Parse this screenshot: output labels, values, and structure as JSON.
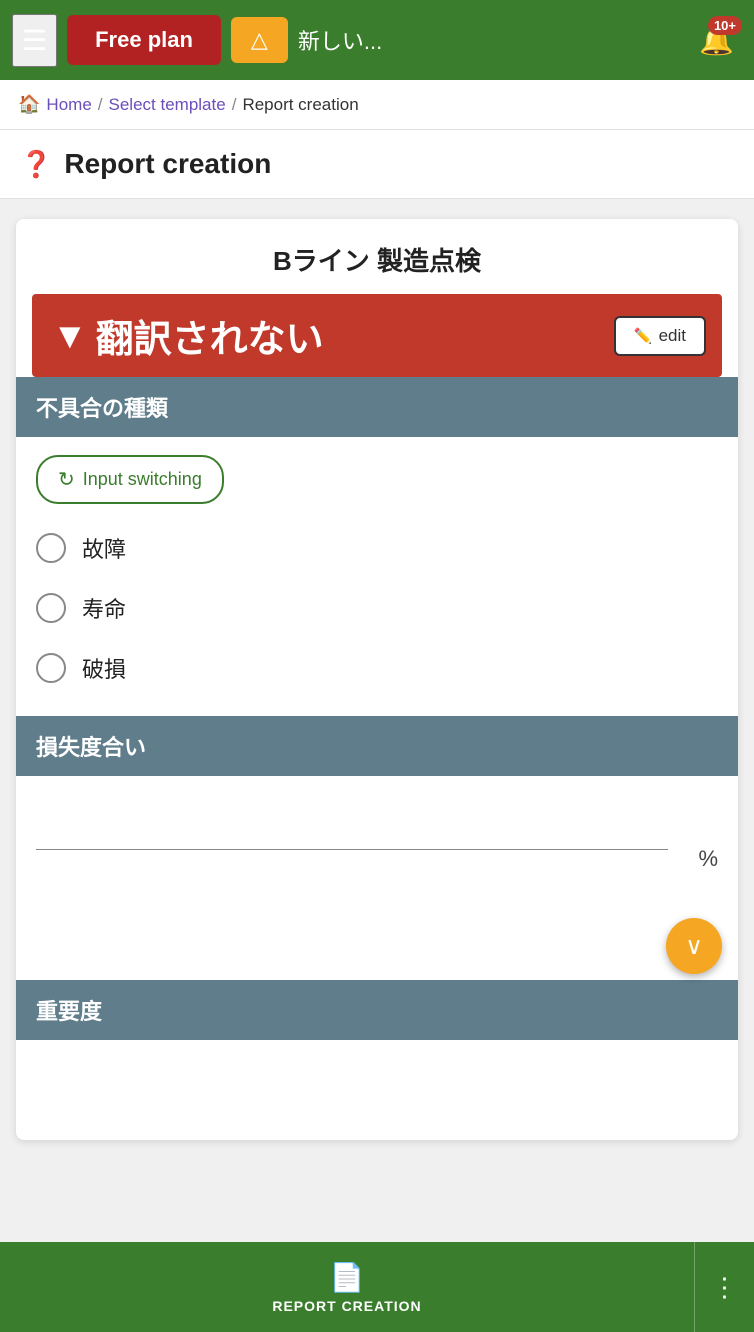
{
  "topbar": {
    "free_plan_label": "Free plan",
    "alert_triangle": "△",
    "alert_text": "新しい...",
    "notification_badge": "10+",
    "colors": {
      "green": "#3a7d2c",
      "red_button": "#b22222",
      "orange": "#f5a623"
    }
  },
  "breadcrumb": {
    "home_icon": "🏠",
    "home_label": "Home",
    "sep1": "/",
    "link1": "Select template",
    "sep2": "/",
    "current": "Report creation"
  },
  "page_title": {
    "help_icon": "?",
    "title": "Report creation"
  },
  "card": {
    "heading": "Bライン 製造点検",
    "red_banner": {
      "arrow": "▼",
      "text": "翻訳されない"
    },
    "edit_button_label": "edit",
    "section1": {
      "header": "不具合の種類",
      "input_switching_label": "Input switching",
      "switch_icon": "↻",
      "options": [
        {
          "label": "故障"
        },
        {
          "label": "寿命"
        },
        {
          "label": "破損"
        }
      ]
    },
    "section2": {
      "header": "損失度合い",
      "percent_label": "%"
    },
    "section3": {
      "header": "重要度"
    },
    "scroll_down_icon": "∨"
  },
  "bottom_nav": {
    "icon": "📄",
    "label": "REPORT CREATION",
    "more_icon": "⋮"
  }
}
